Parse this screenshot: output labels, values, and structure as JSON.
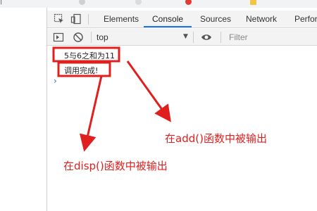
{
  "bookmarks": [
    {
      "label": "|",
      "icon": "bookmark-icon"
    },
    {
      "label": "...",
      "icon": "tab-icon"
    },
    {
      "label": "...",
      "icon": "google-icon"
    },
    {
      "label": "...",
      "icon": "red-circle-icon"
    },
    {
      "label": "...",
      "icon": "folder-icon"
    }
  ],
  "devtools": {
    "tabs": [
      "Elements",
      "Console",
      "Sources",
      "Network",
      "Perfor"
    ],
    "active_tab": "Console",
    "toolbar": {
      "context": "top",
      "filter_placeholder": "Filter"
    },
    "console_messages": [
      {
        "text": "5与6之和为11"
      },
      {
        "text": "调用完成!"
      }
    ],
    "prompt_symbol": "›"
  },
  "annotations": {
    "color": "#e0201f",
    "add_note": "在add()函数中被输出",
    "disp_note": "在disp()函数中被输出"
  }
}
